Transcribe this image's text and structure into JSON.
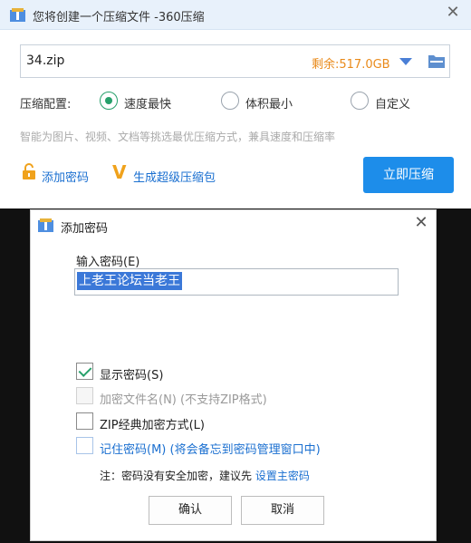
{
  "main_window": {
    "title": "您将创建一个压缩文件 -360压缩",
    "close_glyph": "✕",
    "file_name": "34.zip",
    "free_space": "剩余:517.0GB",
    "config_label": "压缩配置:",
    "options": [
      "速度最快",
      "体积最小",
      "自定义"
    ],
    "selected_option": "速度最快",
    "hint": "智能为图片、视频、文档等挑选最优压缩方式，兼具速度和压缩率",
    "add_password_link": "添加密码",
    "super_compress_link": "生成超级压缩包",
    "v_glyph": "V",
    "compress_button": "立即压缩",
    "accent_color": "#1d8dea"
  },
  "password_dialog": {
    "title": "添加密码",
    "close_glyph": "✕",
    "input_label": "输入密码(E)",
    "password_value": "上老王论坛当老王",
    "checkboxes": [
      {
        "label": "显示密码(S)",
        "checked": true,
        "enabled": true
      },
      {
        "label": "加密文件名(N) (不支持ZIP格式)",
        "checked": false,
        "enabled": false
      },
      {
        "label": "ZIP经典加密方式(L)",
        "checked": false,
        "enabled": true
      },
      {
        "label": "记住密码(M) (将会备忘到密码管理窗口中)",
        "checked": false,
        "enabled": true
      }
    ],
    "note_prefix": "注：密码没有安全加密，建议先 ",
    "note_link": "设置主密码",
    "ok_button": "确认",
    "cancel_button": "取消"
  }
}
